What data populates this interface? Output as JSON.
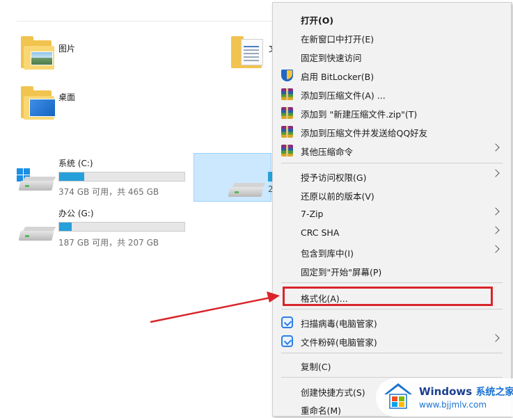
{
  "explorer": {
    "folders": [
      {
        "label": "图片"
      },
      {
        "label": "桌面"
      }
    ],
    "peek_label": "文",
    "drives": [
      {
        "name": "系统 (C:)",
        "space": "374 GB 可用，共 465 GB",
        "used_fraction": 0.2
      },
      {
        "name": "办公 (G:)",
        "space": "187 GB 可用，共 207 GB",
        "used_fraction": 0.1
      }
    ],
    "selected_drive_peek": "2"
  },
  "menu": {
    "items": [
      {
        "label": "打开(O)",
        "bold": true,
        "icon": "",
        "submenu": false
      },
      {
        "label": "在新窗口中打开(E)",
        "icon": "",
        "submenu": false
      },
      {
        "label": "固定到快速访问",
        "icon": "",
        "submenu": false
      },
      {
        "label": "启用 BitLocker(B)",
        "icon": "shield-icon",
        "submenu": false
      },
      {
        "label": "添加到压缩文件(A) ...",
        "icon": "rar-archive-icon",
        "submenu": false
      },
      {
        "label": "添加到 \"新建压缩文件.zip\"(T)",
        "icon": "rar-archive-icon",
        "submenu": false
      },
      {
        "label": "添加到压缩文件并发送给QQ好友",
        "icon": "rar-archive-icon",
        "submenu": false
      },
      {
        "label": "其他压缩命令",
        "icon": "rar-archive-icon",
        "submenu": true
      },
      {
        "label": "授予访问权限(G)",
        "icon": "",
        "submenu": true
      },
      {
        "label": "还原以前的版本(V)",
        "icon": "",
        "submenu": false
      },
      {
        "label": "7-Zip",
        "icon": "",
        "submenu": true
      },
      {
        "label": "CRC SHA",
        "icon": "",
        "submenu": true
      },
      {
        "label": "包含到库中(I)",
        "icon": "",
        "submenu": true
      },
      {
        "label": "固定到\"开始\"屏幕(P)",
        "icon": "",
        "submenu": false
      },
      {
        "label": "格式化(A)...",
        "icon": "",
        "submenu": false,
        "highlighted": true
      },
      {
        "label": "扫描病毒(电脑管家)",
        "icon": "pc-manager-icon",
        "submenu": false
      },
      {
        "label": "文件粉碎(电脑管家)",
        "icon": "pc-manager-icon",
        "submenu": true
      },
      {
        "label": "复制(C)",
        "icon": "",
        "submenu": false
      },
      {
        "label": "创建快捷方式(S)",
        "icon": "",
        "submenu": false
      },
      {
        "label": "重命名(M)",
        "icon": "",
        "submenu": false
      }
    ]
  },
  "annotation": {
    "color": "#d9242a"
  },
  "watermark": {
    "title": "Windows",
    "title_cn": "系统之家",
    "url": "www.bjjmlv.com"
  },
  "colors": {
    "accent": "#26a0da",
    "selection": "#cce8ff",
    "menu_bg": "#f2f2f2"
  }
}
